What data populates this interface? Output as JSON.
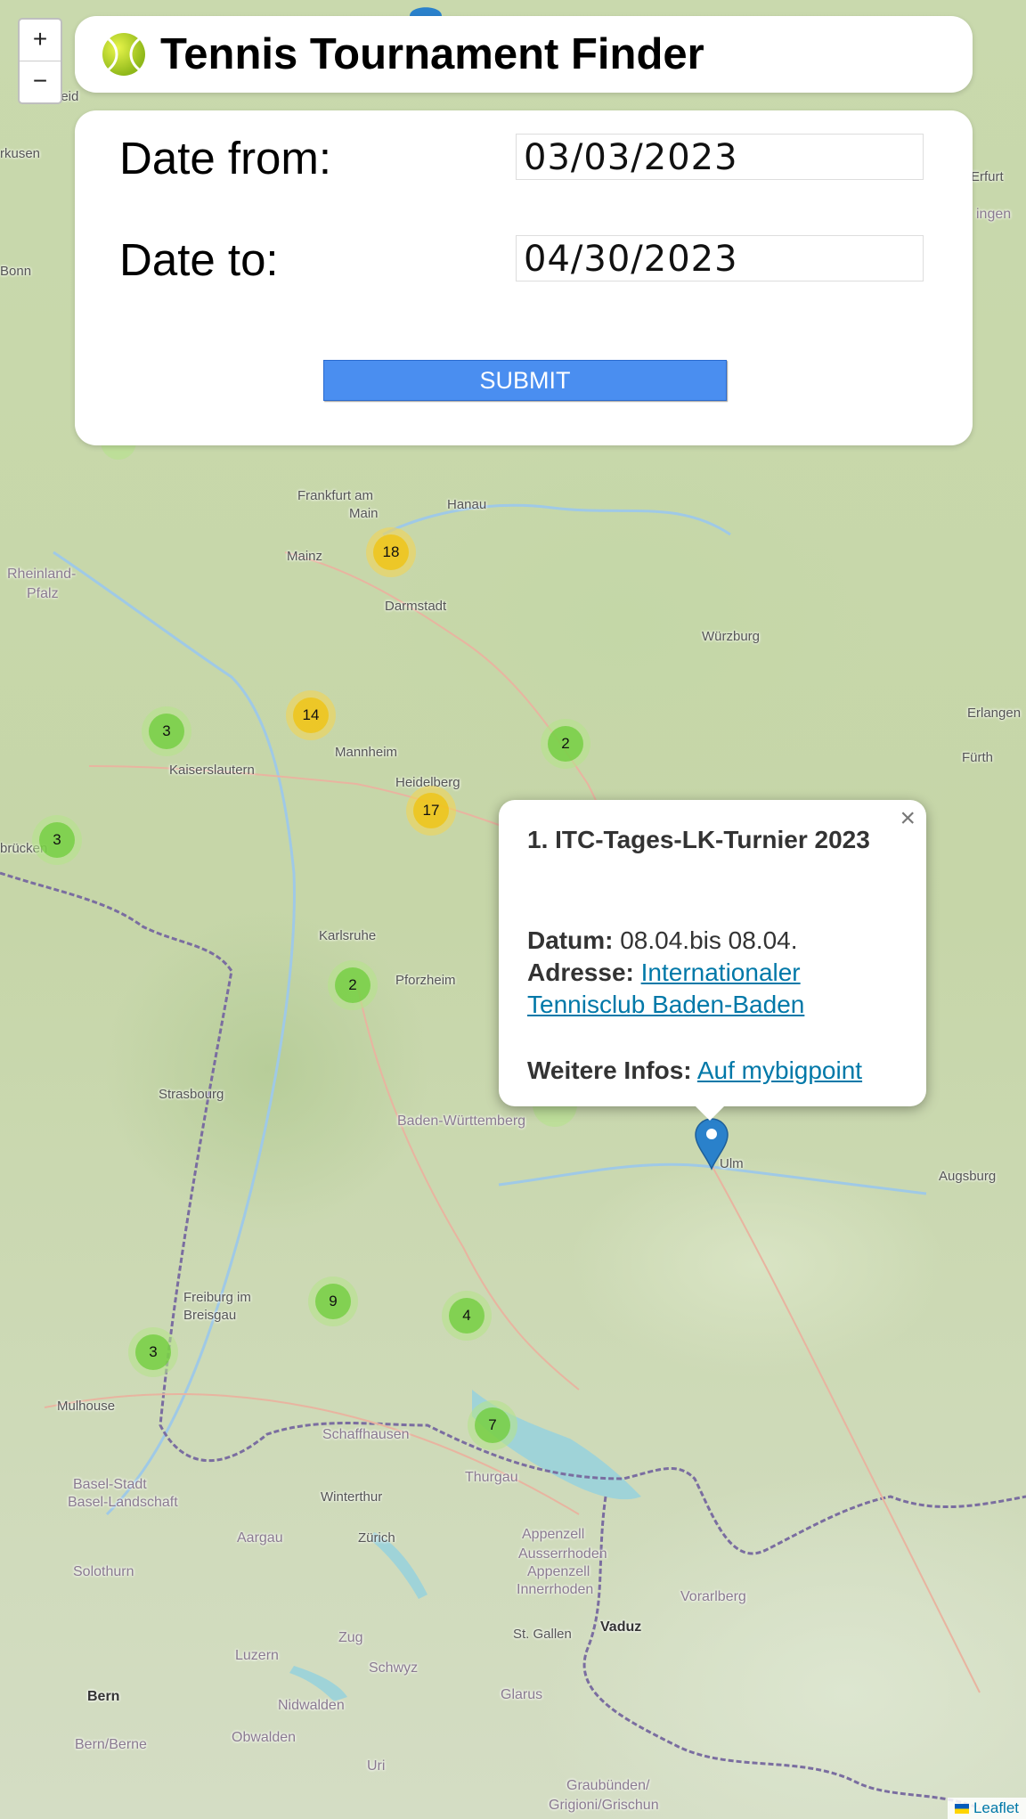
{
  "app": {
    "title": "Tennis Tournament Finder"
  },
  "zoom": {
    "in_label": "+",
    "out_label": "−"
  },
  "form": {
    "date_from_label": "Date from:",
    "date_from_value": "03/03/2023",
    "date_to_label": "Date to:",
    "date_to_value": "04/30/2023",
    "submit_label": "SUBMIT"
  },
  "clusters": [
    {
      "count": "18",
      "level": "medium"
    },
    {
      "count": "14",
      "level": "medium"
    },
    {
      "count": "17",
      "level": "medium"
    },
    {
      "count": "3",
      "level": "small"
    },
    {
      "count": "2",
      "level": "small"
    },
    {
      "count": "3",
      "level": "small"
    },
    {
      "count": "2",
      "level": "small"
    },
    {
      "count": "9",
      "level": "small"
    },
    {
      "count": "4",
      "level": "small"
    },
    {
      "count": "3",
      "level": "small"
    },
    {
      "count": "7",
      "level": "small"
    }
  ],
  "places": {
    "frankfurt": "Frankfurt am",
    "main": "Main",
    "hanau": "Hanau",
    "mainz": "Mainz",
    "darmstadt": "Darmstadt",
    "rheinland": "Rheinland-",
    "pfalz": "Pfalz",
    "wurzburg": "Würzburg",
    "erlangen": "Erlangen",
    "furth": "Fürth",
    "mannheim": "Mannheim",
    "heidelberg": "Heidelberg",
    "kaiserslautern": "Kaiserslautern",
    "saarbrucken": "brücken",
    "karlsruhe": "Karlsruhe",
    "pforzheim": "Pforzheim",
    "strasbourg": "Strasbourg",
    "bw": "Baden-Württemberg",
    "ulm": "Ulm",
    "augsburg": "Augsburg",
    "freiburg1": "Freiburg im",
    "freiburg2": "Breisgau",
    "mulhouse": "Mulhouse",
    "schaffhausen": "Schaffhausen",
    "thurgau": "Thurgau",
    "basel1": "Basel-Stadt",
    "basel2": "Basel-Landschaft",
    "winterthur": "Winterthur",
    "aargau": "Aargau",
    "zurich": "Zürich",
    "appenzell1": "Appenzell",
    "appenzell2": "Ausserrhoden",
    "appenzell3": "Appenzell",
    "appenzell4": "Innerrhoden",
    "vorarlberg": "Vorarlberg",
    "solothurn": "Solothurn",
    "vaduz": "Vaduz",
    "stgallen": "St. Gallen",
    "zug": "Zug",
    "luzern": "Luzern",
    "schwyz": "Schwyz",
    "glarus": "Glarus",
    "bern": "Bern",
    "bernberne": "Bern/Berne",
    "nidwalden": "Nidwalden",
    "obwalden": "Obwalden",
    "uri": "Uri",
    "graubunden1": "Graubünden/",
    "graubunden2": "Grigioni/Grischun",
    "erfurt": "Erfurt",
    "ingen": "ingen",
    "kusen": "rkusen",
    "bonn": "Bonn",
    "heid": "heid"
  },
  "popup": {
    "close": "×",
    "title": "1. ITC-Tages-LK-Turnier 2023",
    "datum_label": "Datum:",
    "datum_value": "08.04.bis 08.04.",
    "adresse_label": "Adresse:",
    "adresse_link": "Internationaler Tennisclub Baden-Baden",
    "infos_label": "Weitere Infos:",
    "infos_link": "Auf mybigpoint"
  },
  "attribution": {
    "link": "Leaflet"
  },
  "colors": {
    "submit": "#4a8ef0",
    "cluster_small": "#6ecc39",
    "cluster_medium": "#f0c20c",
    "link": "#0078a8",
    "marker": "#2a81cb"
  }
}
